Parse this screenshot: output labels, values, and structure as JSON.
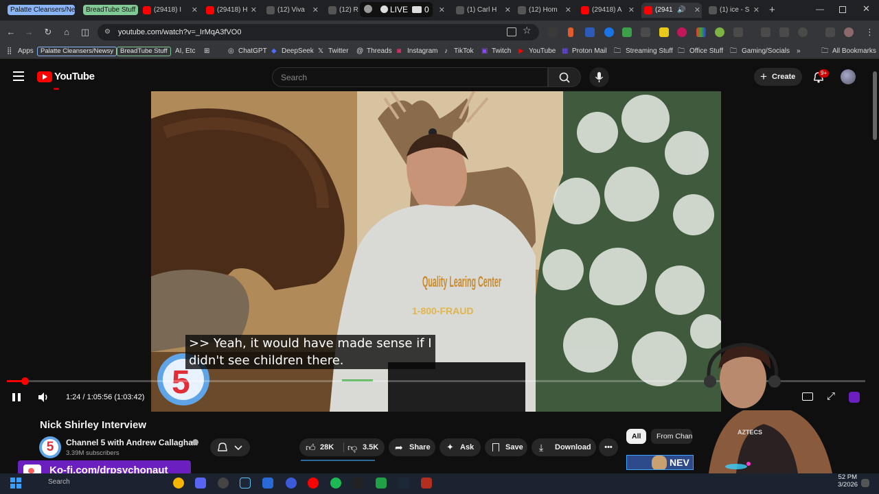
{
  "browser": {
    "tab_groups": [
      "Palatte Cleansers/News",
      "BreadTube Stuff"
    ],
    "tabs": [
      {
        "label": "(29418) I",
        "icon": "youtube-icon"
      },
      {
        "label": "(29418) H",
        "icon": "youtube-icon"
      },
      {
        "label": "(12) Viva",
        "icon": "x-icon"
      },
      {
        "label": "(12) R",
        "icon": "x-icon"
      },
      {
        "label": "(1) Carl H",
        "icon": "x-icon"
      },
      {
        "label": "(12) Hom",
        "icon": "x-icon"
      },
      {
        "label": "(29418) A",
        "icon": "youtube-icon"
      },
      {
        "label": "(2941",
        "icon": "youtube-icon"
      },
      {
        "label": "(1) ice - S",
        "icon": "x-icon"
      }
    ],
    "live_overlay": {
      "label": "LIVE",
      "count": "0"
    },
    "url": "youtube.com/watch?v=_IrMqA3fVO0",
    "bookmarks": {
      "apps_label": "Apps",
      "group_chips": [
        "Palatte Cleansers/Newsy",
        "BreadTube Stuff"
      ],
      "ai_label": "AI, Etc",
      "items": [
        "ChatGPT",
        "DeepSeek",
        "Twitter",
        "Threads",
        "Instagram",
        "TikTok",
        "Twitch",
        "YouTube",
        "Proton Mail"
      ],
      "folders": [
        "Streaming Stuff",
        "Office Stuff",
        "Gaming/Socials"
      ],
      "all_bookmarks": "All Bookmarks"
    }
  },
  "youtube": {
    "logo_text": "YouTube",
    "search_placeholder": "Search",
    "create_label": "Create",
    "notification_badge": "9+",
    "player": {
      "caption_line1": ">> Yeah, it would have made sense if I",
      "caption_line2": "didn't see children there.",
      "time_current": "1:24",
      "time_total": "1:05:56",
      "time_remaining": "(1:03:42)",
      "progress_fraction": 0.021,
      "hoodie_text": "Quality Learing Center",
      "hoodie_phone": "1-800-FRAUD",
      "channel_logo_text": "5"
    },
    "video": {
      "title": "Nick Shirley Interview",
      "channel": "Channel 5 with Andrew Callaghan",
      "subscribers": "3.39M subscribers",
      "likes": "28K",
      "dislikes": "3.5K",
      "share_label": "Share",
      "ask_label": "Ask",
      "save_label": "Save",
      "download_label": "Download"
    },
    "chips": [
      "All",
      "From Chan"
    ],
    "thumb_text": "NEV"
  },
  "overlay": {
    "kofi_text": "Ko-fi.com/drpsychonaut",
    "clock_time": "52 PM",
    "clock_date": "3/2026",
    "webcam_shirt_text": "AZTECS"
  },
  "taskbar": {
    "search_label": "Search"
  },
  "colors": {
    "youtube_red": "#ff0000",
    "kofi_purple": "#6b1fbf",
    "background": "#0f0f0f",
    "group_chip_blue": "#8ab4f8",
    "group_chip_green": "#81c995"
  }
}
